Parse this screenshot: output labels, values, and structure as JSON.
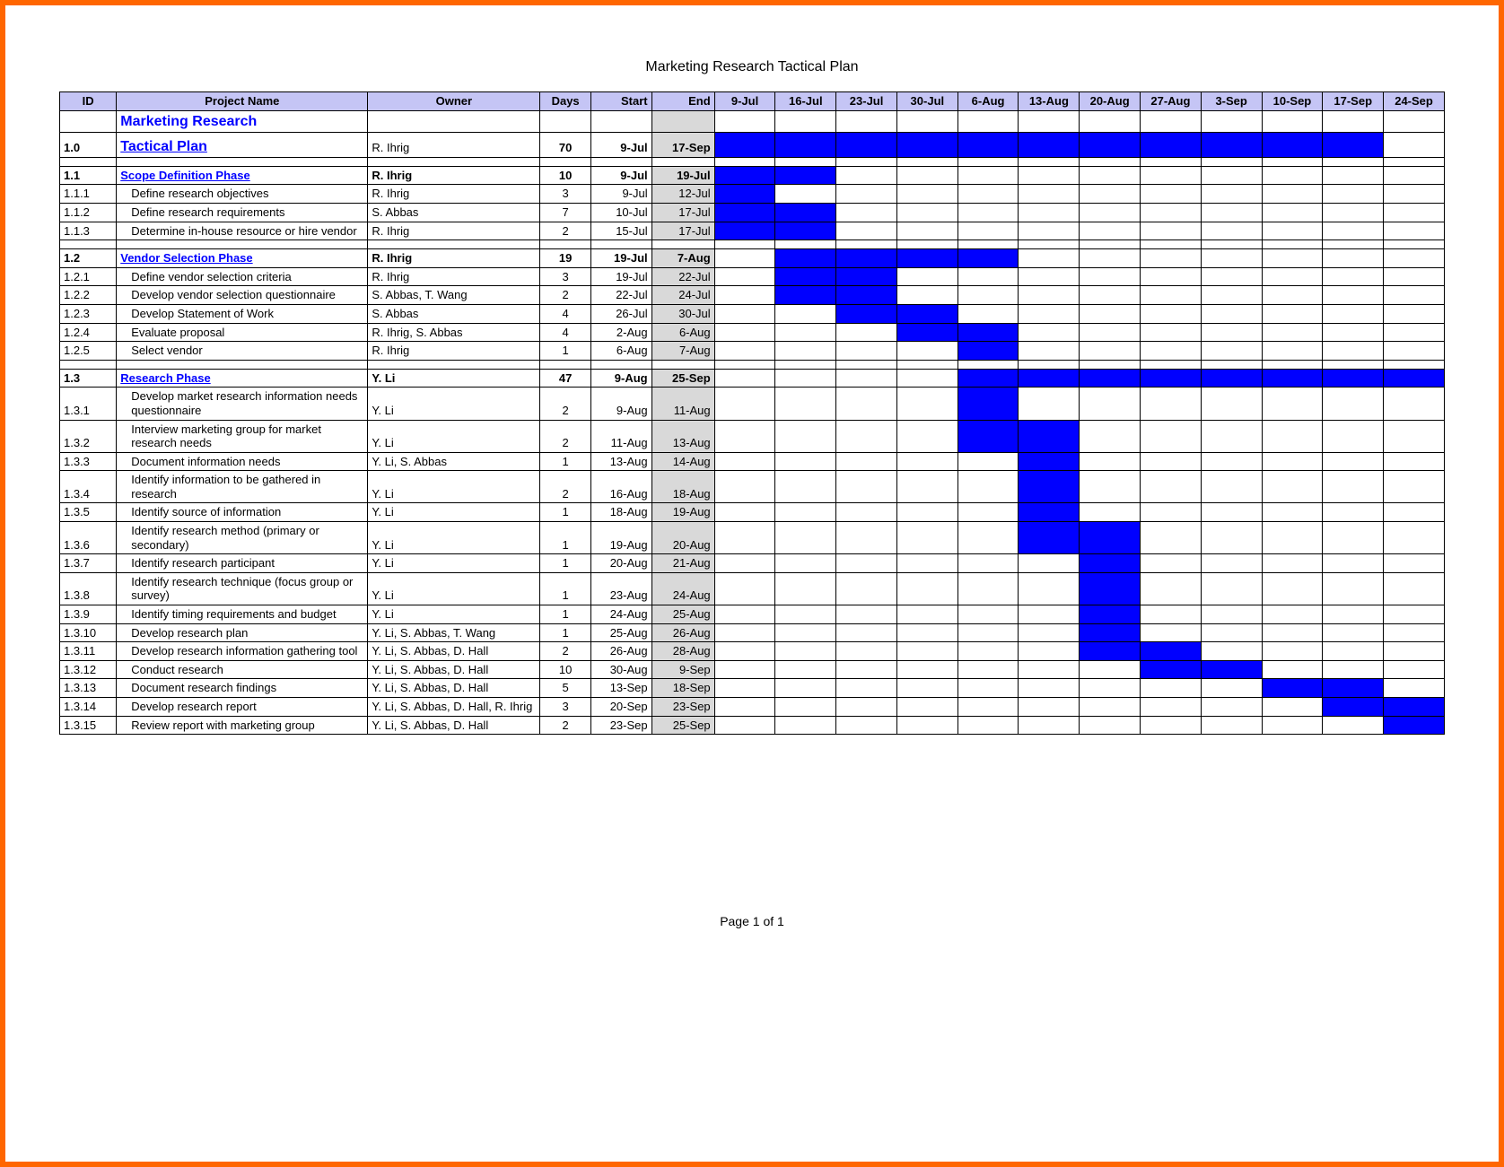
{
  "title": "Marketing Research Tactical Plan",
  "footer": "Page 1 of 1",
  "headers": {
    "id": "ID",
    "project": "Project Name",
    "owner": "Owner",
    "days": "Days",
    "start": "Start",
    "end": "End"
  },
  "date_columns": [
    "9-Jul",
    "16-Jul",
    "23-Jul",
    "30-Jul",
    "6-Aug",
    "13-Aug",
    "20-Aug",
    "27-Aug",
    "3-Sep",
    "10-Sep",
    "17-Sep",
    "24-Sep"
  ],
  "rows": [
    {
      "type": "title2",
      "id": "",
      "project": "Marketing Research",
      "owner": "",
      "days": "",
      "start": "",
      "end": "",
      "gantt": []
    },
    {
      "type": "title",
      "id": "1.0",
      "project": "Tactical Plan",
      "owner": "R. Ihrig",
      "days": "70",
      "start": "9-Jul",
      "end": "17-Sep",
      "gantt": [
        0,
        1,
        2,
        3,
        4,
        5,
        6,
        7,
        8,
        9,
        10
      ]
    },
    {
      "type": "spacer"
    },
    {
      "type": "phase",
      "id": "1.1",
      "project": "Scope Definition Phase",
      "owner": "R. Ihrig",
      "days": "10",
      "start": "9-Jul",
      "end": "19-Jul",
      "gantt": [
        0,
        1
      ]
    },
    {
      "type": "task",
      "id": "1.1.1",
      "project": "Define research objectives",
      "owner": "R. Ihrig",
      "days": "3",
      "start": "9-Jul",
      "end": "12-Jul",
      "gantt": [
        0
      ]
    },
    {
      "type": "task",
      "id": "1.1.2",
      "project": "Define research requirements",
      "owner": "S. Abbas",
      "days": "7",
      "start": "10-Jul",
      "end": "17-Jul",
      "gantt": [
        0,
        1
      ]
    },
    {
      "type": "task",
      "id": "1.1.3",
      "project": "Determine in-house resource or hire vendor",
      "owner": "R. Ihrig",
      "days": "2",
      "start": "15-Jul",
      "end": "17-Jul",
      "gantt": [
        0,
        1
      ]
    },
    {
      "type": "spacer"
    },
    {
      "type": "phase",
      "id": "1.2",
      "project": "Vendor Selection Phase",
      "owner": "R. Ihrig",
      "days": "19",
      "start": "19-Jul",
      "end": "7-Aug",
      "gantt": [
        1,
        2,
        3,
        4
      ]
    },
    {
      "type": "task",
      "id": "1.2.1",
      "project": "Define vendor selection criteria",
      "owner": "R. Ihrig",
      "days": "3",
      "start": "19-Jul",
      "end": "22-Jul",
      "gantt": [
        1,
        2
      ]
    },
    {
      "type": "task",
      "id": "1.2.2",
      "project": "Develop vendor selection questionnaire",
      "owner": "S. Abbas, T. Wang",
      "days": "2",
      "start": "22-Jul",
      "end": "24-Jul",
      "gantt": [
        1,
        2
      ]
    },
    {
      "type": "task",
      "id": "1.2.3",
      "project": "Develop Statement of Work",
      "owner": "S. Abbas",
      "days": "4",
      "start": "26-Jul",
      "end": "30-Jul",
      "gantt": [
        2,
        3
      ]
    },
    {
      "type": "task",
      "id": "1.2.4",
      "project": "Evaluate proposal",
      "owner": "R. Ihrig, S. Abbas",
      "days": "4",
      "start": "2-Aug",
      "end": "6-Aug",
      "gantt": [
        3,
        4
      ]
    },
    {
      "type": "task",
      "id": "1.2.5",
      "project": "Select vendor",
      "owner": "R. Ihrig",
      "days": "1",
      "start": "6-Aug",
      "end": "7-Aug",
      "gantt": [
        4
      ]
    },
    {
      "type": "spacer"
    },
    {
      "type": "phase",
      "id": "1.3",
      "project": "Research Phase",
      "owner": "Y. Li",
      "days": "47",
      "start": "9-Aug",
      "end": "25-Sep",
      "gantt": [
        4,
        5,
        6,
        7,
        8,
        9,
        10,
        11
      ]
    },
    {
      "type": "task",
      "id": "1.3.1",
      "project": "Develop market research information needs questionnaire",
      "owner": "Y. Li",
      "days": "2",
      "start": "9-Aug",
      "end": "11-Aug",
      "gantt": [
        4
      ]
    },
    {
      "type": "task",
      "id": "1.3.2",
      "project": "Interview marketing group for market research needs",
      "owner": "Y. Li",
      "days": "2",
      "start": "11-Aug",
      "end": "13-Aug",
      "gantt": [
        4,
        5
      ]
    },
    {
      "type": "task",
      "id": "1.3.3",
      "project": "Document information needs",
      "owner": "Y. Li, S. Abbas",
      "days": "1",
      "start": "13-Aug",
      "end": "14-Aug",
      "gantt": [
        5
      ]
    },
    {
      "type": "task",
      "id": "1.3.4",
      "project": "Identify information to be gathered in research",
      "owner": "Y. Li",
      "days": "2",
      "start": "16-Aug",
      "end": "18-Aug",
      "gantt": [
        5
      ]
    },
    {
      "type": "task",
      "id": "1.3.5",
      "project": "Identify source of information",
      "owner": "Y. Li",
      "days": "1",
      "start": "18-Aug",
      "end": "19-Aug",
      "gantt": [
        5
      ]
    },
    {
      "type": "task",
      "id": "1.3.6",
      "project": "Identify research method (primary or secondary)",
      "owner": "Y. Li",
      "days": "1",
      "start": "19-Aug",
      "end": "20-Aug",
      "gantt": [
        5,
        6
      ]
    },
    {
      "type": "task",
      "id": "1.3.7",
      "project": "Identify research participant",
      "owner": "Y. Li",
      "days": "1",
      "start": "20-Aug",
      "end": "21-Aug",
      "gantt": [
        6
      ]
    },
    {
      "type": "task",
      "id": "1.3.8",
      "project": "Identify research technique (focus group or survey)",
      "owner": "Y. Li",
      "days": "1",
      "start": "23-Aug",
      "end": "24-Aug",
      "gantt": [
        6
      ]
    },
    {
      "type": "task",
      "id": "1.3.9",
      "project": "Identify timing requirements and budget",
      "owner": "Y. Li",
      "days": "1",
      "start": "24-Aug",
      "end": "25-Aug",
      "gantt": [
        6
      ]
    },
    {
      "type": "task",
      "id": "1.3.10",
      "project": "Develop research plan",
      "owner": "Y. Li, S. Abbas, T. Wang",
      "days": "1",
      "start": "25-Aug",
      "end": "26-Aug",
      "gantt": [
        6
      ]
    },
    {
      "type": "task",
      "id": "1.3.11",
      "project": "Develop research information gathering tool",
      "owner": "Y. Li, S. Abbas, D. Hall",
      "days": "2",
      "start": "26-Aug",
      "end": "28-Aug",
      "gantt": [
        6,
        7
      ]
    },
    {
      "type": "task",
      "id": "1.3.12",
      "project": "Conduct research",
      "owner": "Y. Li, S. Abbas, D. Hall",
      "days": "10",
      "start": "30-Aug",
      "end": "9-Sep",
      "gantt": [
        7,
        8
      ]
    },
    {
      "type": "task",
      "id": "1.3.13",
      "project": "Document research findings",
      "owner": "Y. Li, S. Abbas, D. Hall",
      "days": "5",
      "start": "13-Sep",
      "end": "18-Sep",
      "gantt": [
        9,
        10
      ]
    },
    {
      "type": "task",
      "id": "1.3.14",
      "project": "Develop research report",
      "owner": "Y. Li, S. Abbas, D. Hall, R. Ihrig",
      "days": "3",
      "start": "20-Sep",
      "end": "23-Sep",
      "gantt": [
        10,
        11
      ]
    },
    {
      "type": "task",
      "id": "1.3.15",
      "project": "Review report with marketing group",
      "owner": "Y. Li, S. Abbas, D. Hall",
      "days": "2",
      "start": "23-Sep",
      "end": "25-Sep",
      "gantt": [
        11
      ]
    }
  ]
}
